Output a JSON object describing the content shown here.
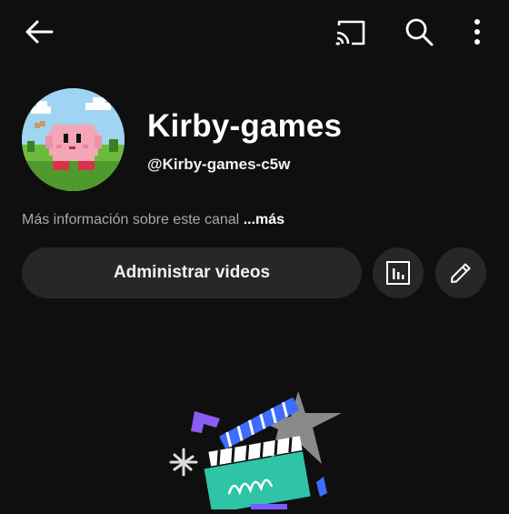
{
  "header": {
    "back_icon": "arrow-left-icon",
    "cast_icon": "cast-icon",
    "search_icon": "search-icon",
    "more_icon": "more-vertical-icon"
  },
  "channel": {
    "name": "Kirby-games",
    "handle": "@Kirby-games-c5w",
    "about_text": "Más información sobre este canal",
    "about_more": "...más",
    "avatar_icon": "kirby-avatar"
  },
  "actions": {
    "manage_videos_label": "Administrar videos",
    "analytics_icon": "analytics-icon",
    "edit_icon": "pencil-icon"
  },
  "empty_state": {
    "illustration_icon": "clapperboard-illustration"
  },
  "colors": {
    "background": "#0f0f0f",
    "button_bg": "#272727",
    "secondary_text": "#aaaaaa",
    "illustration_teal": "#2ec4a5",
    "illustration_purple": "#7b5cff",
    "illustration_blue": "#3e6cff"
  }
}
